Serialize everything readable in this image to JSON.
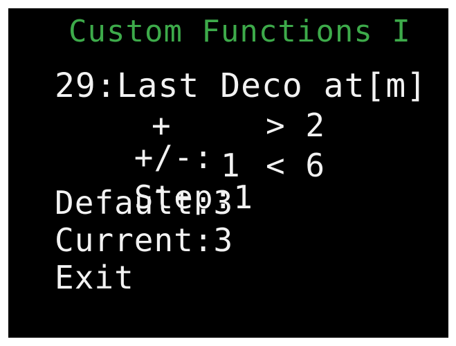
{
  "screen": {
    "title": "Custom Functions I",
    "parameter": "29:Last Deco at[m]",
    "sign_label": "+/-:",
    "sign_value": "+",
    "upper_limit": "> 2",
    "step_label": "Step:1",
    "step_min": "1",
    "lower_limit": "< 6",
    "default": "Default:3",
    "current": "Current:3",
    "exit": "Exit"
  },
  "colors": {
    "background": "#000000",
    "title": "#3daa4a",
    "text": "#f2f2f2",
    "frame": "#ffffff"
  }
}
